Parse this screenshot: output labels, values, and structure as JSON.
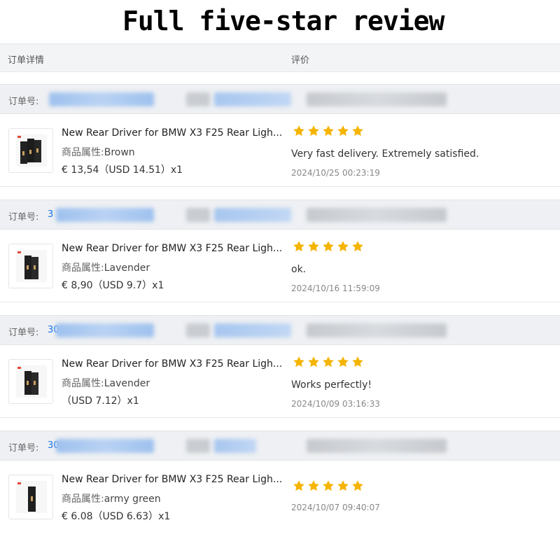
{
  "banner": {
    "title": "Full five-star review"
  },
  "table_header": {
    "left": "订单详情",
    "right": "评价"
  },
  "order_label": "订单号:",
  "star_color": "#f5b400",
  "orders": [
    {
      "order_visible": "",
      "title": "New Rear Driver for BMW X3 F25 Rear Ligh...",
      "attr_label": "商品属性:",
      "attr_value": "Brown",
      "price": "€ 13,54（USD  14.51）x1",
      "rating": 5,
      "comment": "Very fast delivery. Extremely satisfied.",
      "date": "2024/10/25 00:23:19"
    },
    {
      "order_visible": "3",
      "title": "New Rear Driver for BMW X3 F25 Rear Ligh...",
      "attr_label": "商品属性:",
      "attr_value": "Lavender",
      "price": "€ 8,90（USD  9.7）x1",
      "rating": 5,
      "comment": "ok.",
      "date": "2024/10/16 11:59:09"
    },
    {
      "order_visible": "30",
      "title": "New Rear Driver for BMW X3 F25 Rear Ligh...",
      "attr_label": "商品属性:",
      "attr_value": "Lavender",
      "price": "（USD  7.12）x1",
      "rating": 5,
      "comment": "Works perfectly!",
      "date": "2024/10/09 03:16:33"
    },
    {
      "order_visible": "30",
      "title": "New Rear Driver for BMW X3 F25 Rear Ligh...",
      "attr_label": "商品属性:",
      "attr_value": "army green",
      "price": "€ 6.08（USD  6.63）x1",
      "rating": 5,
      "comment": "",
      "date": "2024/10/07 09:40:07"
    }
  ]
}
